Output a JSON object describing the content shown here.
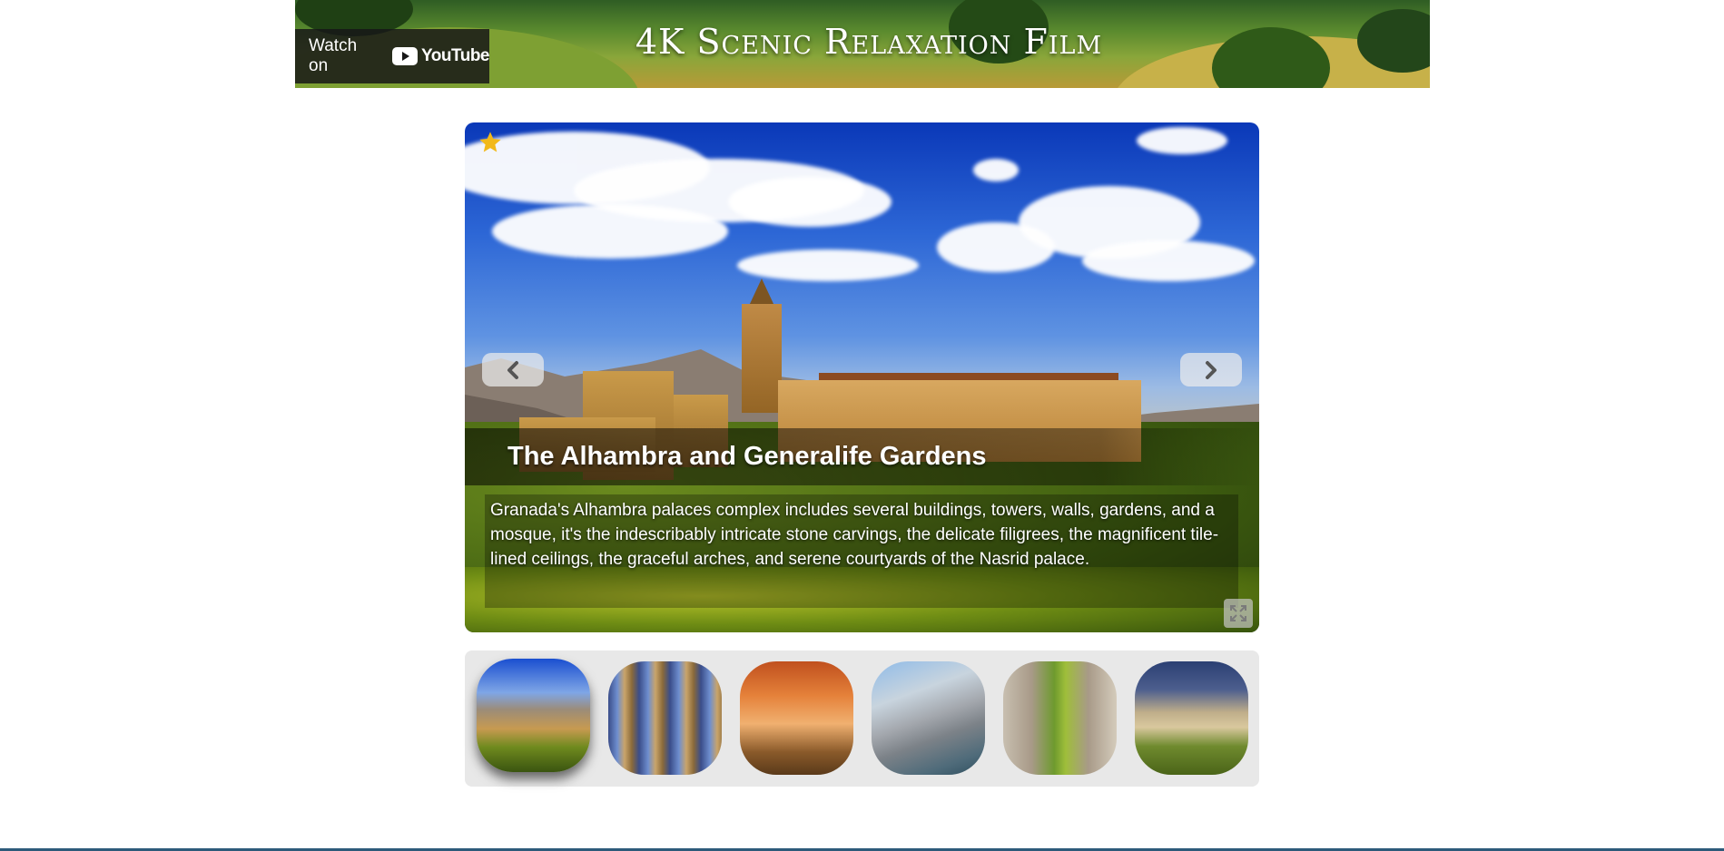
{
  "banner": {
    "title": "4K Scenic Relaxation Film",
    "watch_on_label": "Watch on",
    "youtube_label": "YouTube"
  },
  "slide": {
    "title": "The Alhambra and Generalife Gardens",
    "description": "Granada's Alhambra palaces complex includes several buildings, towers, walls, gardens, and a mosque, it's the indescribably intricate stone carvings, the delicate filigrees, the magnificent tile-lined ceilings, the graceful arches, and serene courtyards of the Nasrid palace.",
    "favorite_icon": "star-icon",
    "prev_icon": "chevron-left-icon",
    "next_icon": "chevron-right-icon",
    "fullscreen_icon": "fullscreen-icon"
  },
  "thumbnails": {
    "count": 6,
    "active_index": 0
  },
  "colors": {
    "star": "#f2b91a",
    "thumb_strip_bg": "#e8e8e8",
    "bottom_line": "#2d5a7a"
  }
}
